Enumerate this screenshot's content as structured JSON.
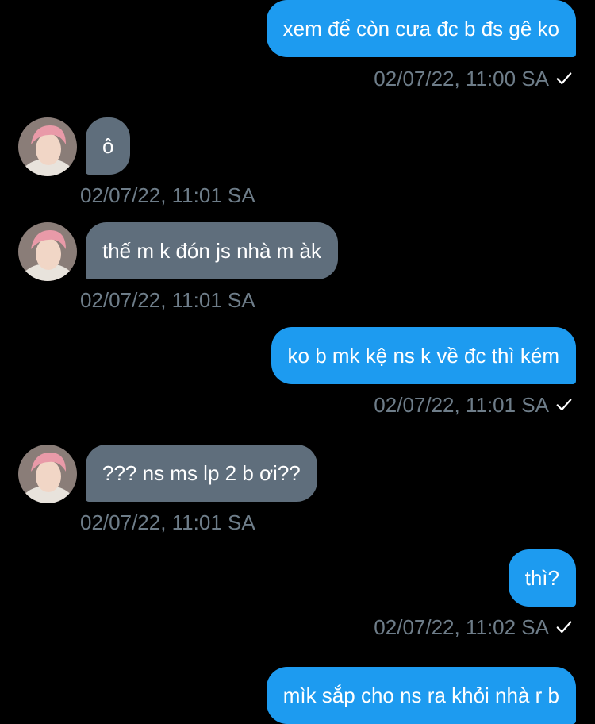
{
  "colors": {
    "background": "#000000",
    "sent_bubble": "#1d9bf0",
    "received_bubble": "#5f6e7c",
    "timestamp": "#6e7d89"
  },
  "messages": [
    {
      "direction": "sent",
      "text": "xem để còn cưa đc b đs gê ko",
      "timestamp": "02/07/22, 11:00 SA",
      "status_icon": "check-icon"
    },
    {
      "direction": "received",
      "text": "ô",
      "timestamp": "02/07/22, 11:01 SA",
      "avatar_icon": "user-avatar"
    },
    {
      "direction": "received",
      "text": "thế m k đón js nhà m àk",
      "timestamp": "02/07/22, 11:01 SA",
      "avatar_icon": "user-avatar"
    },
    {
      "direction": "sent",
      "text": "ko b mk kệ ns k về đc thì kém",
      "timestamp": "02/07/22, 11:01 SA",
      "status_icon": "check-icon"
    },
    {
      "direction": "received",
      "text": "??? ns ms lp 2 b ơi??",
      "timestamp": "02/07/22, 11:01 SA",
      "avatar_icon": "user-avatar"
    },
    {
      "direction": "sent",
      "text": "thì?",
      "timestamp": "02/07/22, 11:02 SA",
      "status_icon": "check-icon"
    },
    {
      "direction": "sent",
      "text": "mìk sắp cho ns ra khỏi nhà r b"
    }
  ]
}
